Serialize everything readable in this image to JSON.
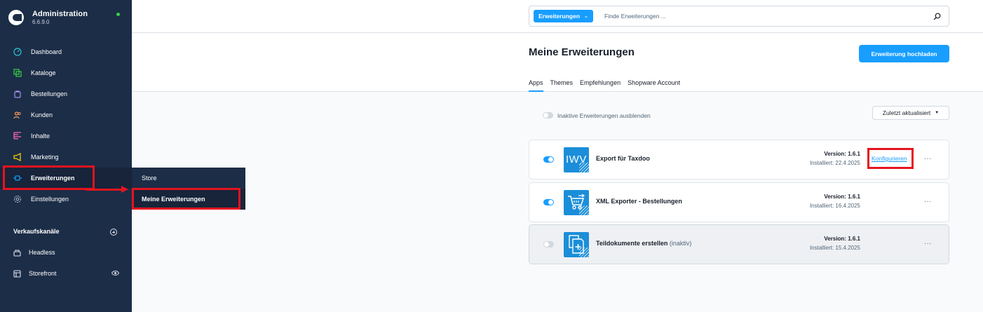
{
  "app": {
    "title": "Administration",
    "version": "6.6.9.0"
  },
  "nav": {
    "items": [
      {
        "label": "Dashboard"
      },
      {
        "label": "Kataloge"
      },
      {
        "label": "Bestellungen"
      },
      {
        "label": "Kunden"
      },
      {
        "label": "Inhalte"
      },
      {
        "label": "Marketing"
      },
      {
        "label": "Erweiterungen"
      },
      {
        "label": "Einstellungen"
      }
    ],
    "icon_colors": {
      "dashboard": "#2ec4d6",
      "kataloge": "#37d046",
      "bestellungen": "#a092f0",
      "kunden": "#ff9b5e",
      "inhalte": "#ff68b4",
      "marketing": "#ffd700",
      "erweiterungen": "#189eff",
      "einstellungen": "#9aa8b5"
    }
  },
  "sales_channels": {
    "title": "Verkaufskanäle",
    "items": [
      {
        "label": "Headless"
      },
      {
        "label": "Storefront"
      }
    ]
  },
  "flyout": {
    "items": [
      {
        "label": "Store"
      },
      {
        "label": "Meine Erweiterungen"
      }
    ]
  },
  "search": {
    "type_label": "Erweiterungen",
    "placeholder": "Finde Erweiterungen ..."
  },
  "page": {
    "title": "Meine Erweiterungen",
    "upload_label": "Erweiterung hochladen",
    "tabs": [
      {
        "label": "Apps"
      },
      {
        "label": "Themes"
      },
      {
        "label": "Empfehlungen"
      },
      {
        "label": "Shopware Account"
      }
    ],
    "hide_inactive_label": "Inaktive Erweiterungen ausblenden",
    "sort_label": "Zuletzt aktualisiert"
  },
  "extensions": [
    {
      "name": "Export für Taxdoo",
      "status": "",
      "version": "Version: 1.6.1",
      "installed": "Installiert: 22.4.2025",
      "configure": "Konfigurieren",
      "more": "...",
      "icon_text": "IWV",
      "active": true
    },
    {
      "name": "XML Exporter - Bestellungen",
      "status": "",
      "version": "Version: 1.6.1",
      "installed": "Installiert: 16.4.2025",
      "more": "...",
      "active": true
    },
    {
      "name": "Teildokumente erstellen",
      "status": "(inaktiv)",
      "version": "Version: 1.6.1",
      "installed": "Installiert: 15.4.2025",
      "more": "...",
      "active": false
    }
  ],
  "colors": {
    "accent": "#189eff",
    "sidebar": "#1c2d47",
    "highlight": "#e5141e"
  }
}
